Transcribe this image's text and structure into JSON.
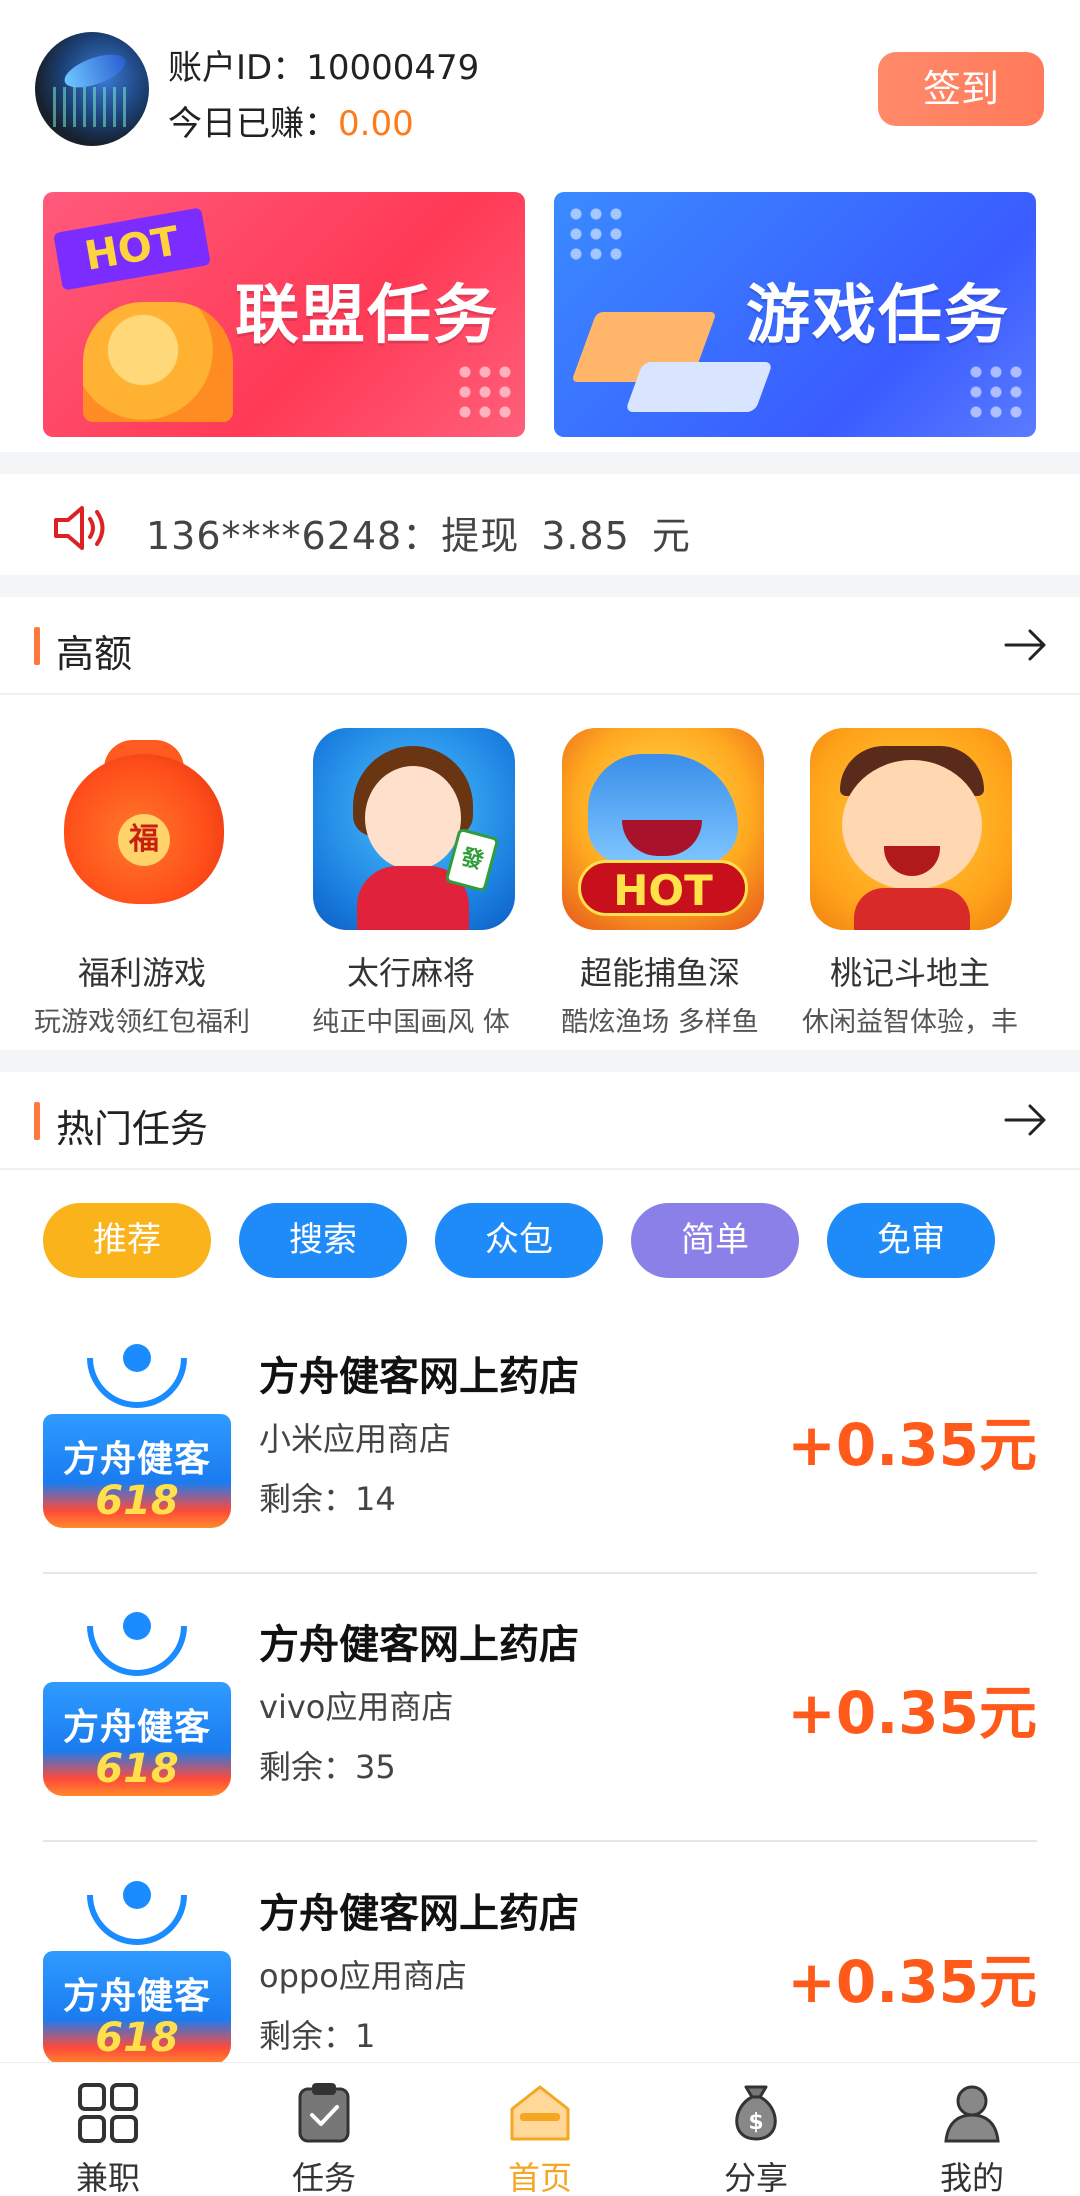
{
  "header": {
    "account_id": "账户ID：10000479",
    "earned_label": "今日已赚：",
    "earned_value": "0.00",
    "signin_label": "签到"
  },
  "banners": [
    {
      "tag": "HOT",
      "title": "联盟任务"
    },
    {
      "title": "游戏任务"
    }
  ],
  "notice": {
    "phone": "136****6248：提现",
    "amount": "3.85",
    "unit": "元"
  },
  "high_section": {
    "title": "高额",
    "games": [
      {
        "name": "福利游戏",
        "desc": "玩游戏领红包福利",
        "icon_text": "福"
      },
      {
        "name": "太行麻将",
        "desc": "纯正中国画风 体",
        "icon_text": "發"
      },
      {
        "name": "超能捕鱼深",
        "desc": "酷炫渔场 多样鱼",
        "icon_text": "HOT"
      },
      {
        "name": "桃记斗地主",
        "desc": "休闲益智体验，丰"
      }
    ]
  },
  "hot_section": {
    "title": "热门任务",
    "tabs": [
      {
        "label": "推荐",
        "color": "#fbb31c"
      },
      {
        "label": "搜索",
        "color": "#1e8bf8"
      },
      {
        "label": "众包",
        "color": "#1e8bf8"
      },
      {
        "label": "简单",
        "color": "#8b7fe8"
      },
      {
        "label": "免审",
        "color": "#1e8bf8"
      }
    ],
    "tasks": [
      {
        "title": "方舟健客网上药店",
        "store": "小米应用商店",
        "remain": "剩余：14",
        "reward": "+0.35元",
        "icon_brand": "方舟健客",
        "icon_num": "618"
      },
      {
        "title": "方舟健客网上药店",
        "store": "vivo应用商店",
        "remain": "剩余：35",
        "reward": "+0.35元",
        "icon_brand": "方舟健客",
        "icon_num": "618"
      },
      {
        "title": "方舟健客网上药店",
        "store": "oppo应用商店",
        "remain": "剩余：1",
        "reward": "+0.35元",
        "icon_brand": "方舟健客",
        "icon_num": "618"
      }
    ]
  },
  "bottom_nav": [
    {
      "label": "兼职",
      "icon": "grid-icon"
    },
    {
      "label": "任务",
      "icon": "clipboard-check-icon"
    },
    {
      "label": "首页",
      "icon": "home-box-icon",
      "active": true
    },
    {
      "label": "分享",
      "icon": "money-bag-icon"
    },
    {
      "label": "我的",
      "icon": "user-icon"
    }
  ],
  "colors": {
    "accent_orange": "#ff7a1a",
    "reward_red": "#ff5a1a",
    "nav_active": "#f5a623"
  }
}
